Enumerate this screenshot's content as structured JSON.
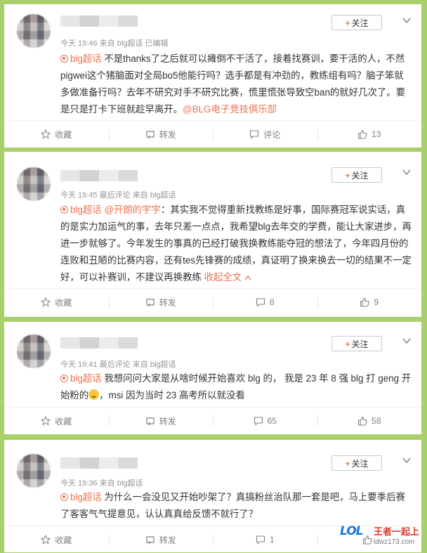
{
  "follow_label": "关注",
  "actions": {
    "favorite": "收藏",
    "repost": "转发"
  },
  "posts": [
    {
      "meta": "今天 19:46 来自 blg超话  已编辑",
      "topic": "blg超话",
      "text": " 不是thanks了之后就可以瘫倒不干活了，接着找赛训，要干活的人，不然pigwei这个猪脑面对全局bo5他能行吗？选手都是有冲劲的，教练组有吗？脑子笨就多做准备行吗？去年不研究对手不研究比赛，慌里慌张导致空ban的就好几次了。要是只是打卡下班就趁早离开。",
      "mention": "@BLG电子竞技俱乐部",
      "comment": "评论",
      "likes": "13"
    },
    {
      "meta": "今天 19:45 最后评论 来自 blg超话",
      "topic": "blg超话",
      "mention": "@开朗的宇宇",
      "text": "：其实我不觉得重新找教练是好事，国际赛冠军说实话，真的是实力加运气的事，去年只差一点点，我希望blg去年交的学费，能让大家进步，再进一步就够了。今年发生的事真的已经打破我换教练能夺冠的想法了，今年四月份的连败和丑陋的比赛内容，还有tes先锋赛的成绩，真证明了换来换去一切的结果不一定好，可以补赛训，不建议再换教练",
      "collapse": "收起全文",
      "comment": "8",
      "likes": "9"
    },
    {
      "meta": "今天 19:41 最后评论 来自 blg超话",
      "topic": "blg超话",
      "text_a": " 我想问问大家是从啥时候开始喜欢 blg 的， 我是 23 年 8 强 blg 打 geng 开始粉的",
      "text_b": "，msi 因为当时 23 高考所以就没看",
      "comment": "65",
      "likes": "58"
    },
    {
      "meta": "今天 19:36 来自 blg超话",
      "topic": "blg超话",
      "text": " 为什么一会没见又开始吵架了？真搞粉丝治队那一套是吧，马上要季后赛了客客气气提意见，认认真真给反馈不就行了？",
      "comment": "1",
      "likes": ""
    }
  ],
  "watermark": {
    "logo": "LOL",
    "title": "王者一起上",
    "url": "ldwz173.com"
  }
}
